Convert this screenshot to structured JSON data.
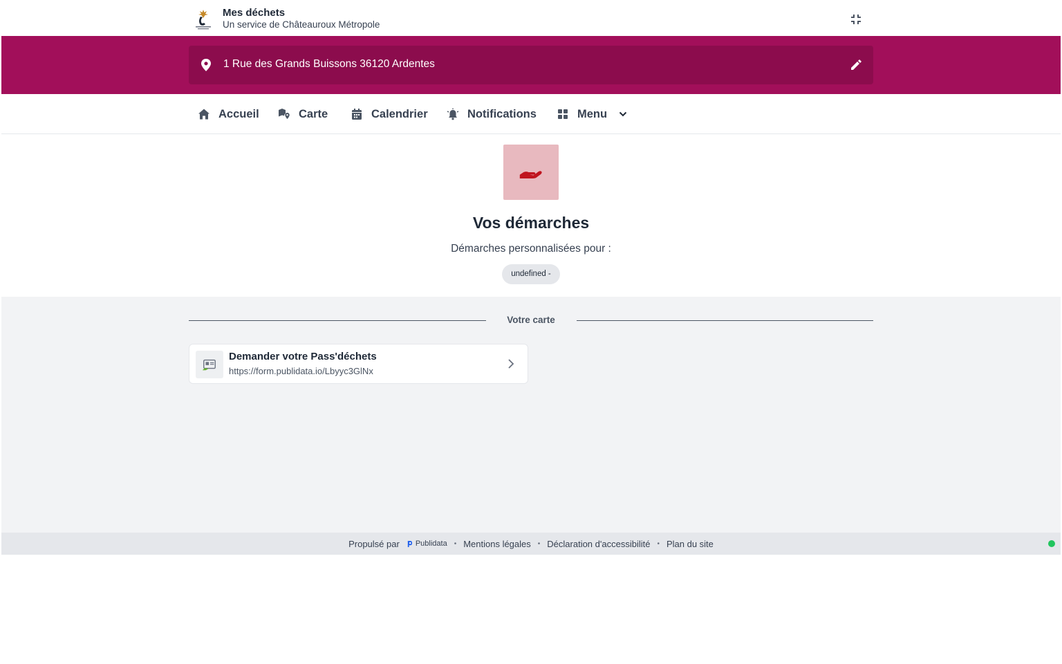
{
  "header": {
    "title": "Mes déchets",
    "subtitle": "Un service de Châteauroux Métropole",
    "logo_icon": "chateauroux-metropole-logo"
  },
  "address": {
    "text": "1 Rue des Grands Buissons 36120 Ardentes",
    "pin_icon": "map-pin-icon",
    "edit_icon": "pencil-icon"
  },
  "nav": {
    "items": [
      {
        "label": "Accueil",
        "icon": "home-icon"
      },
      {
        "label": "Carte",
        "icon": "map-marker-icon"
      },
      {
        "label": "Calendrier",
        "icon": "calendar-icon"
      },
      {
        "label": "Notifications",
        "icon": "bell-icon"
      },
      {
        "label": "Menu",
        "icon": "grid-icon"
      }
    ]
  },
  "hero": {
    "icon": "hand-holding-icon",
    "title": "Vos démarches",
    "subtitle": "Démarches personnalisées pour :",
    "chip": "undefined -"
  },
  "section": {
    "label": "Votre carte"
  },
  "card": {
    "title": "Demander votre Pass'déchets",
    "url": "https://form.publidata.io/Lbyyc3GlNx",
    "icon": "id-card-icon"
  },
  "footer": {
    "powered_by": "Propulsé par",
    "brand": "Publidata",
    "links": [
      "Mentions légales",
      "Déclaration d'accessibilité",
      "Plan du site"
    ]
  },
  "colors": {
    "brand": "#a20f5a",
    "brand_dark": "#8c0c4d",
    "hero_icon_bg": "#e8b9bf",
    "hero_icon": "#c0141f",
    "status": "#22c55e"
  }
}
